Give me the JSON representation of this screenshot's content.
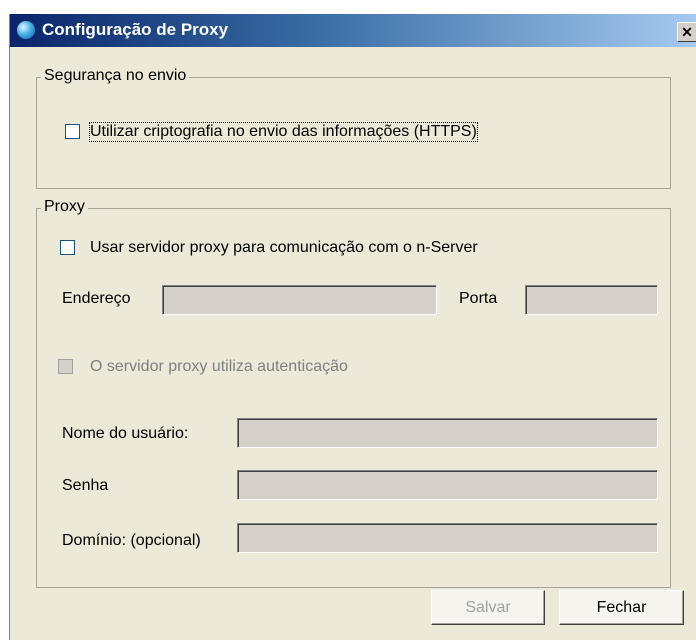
{
  "window": {
    "title": "Configuração de Proxy",
    "close_glyph": "✕",
    "icon": "app-globe-icon"
  },
  "security_group": {
    "legend": "Segurança no envio",
    "https_checkbox": {
      "label": "Utilizar criptografia no envio das informações (HTTPS)",
      "checked": false
    }
  },
  "proxy_group": {
    "legend": "Proxy",
    "use_proxy_checkbox": {
      "label": "Usar servidor proxy para comunicação com o n-Server",
      "checked": false
    },
    "address_label": "Endereço",
    "address_value": "",
    "port_label": "Porta",
    "port_value": "",
    "auth_checkbox": {
      "label": "O servidor proxy utiliza autenticação",
      "checked": false,
      "enabled": false
    },
    "username_label": "Nome do usuário:",
    "username_value": "",
    "password_label": "Senha",
    "password_value": "",
    "domain_label": "Domínio: (opcional)",
    "domain_value": ""
  },
  "buttons": {
    "save_label": "Salvar",
    "close_label": "Fechar"
  }
}
